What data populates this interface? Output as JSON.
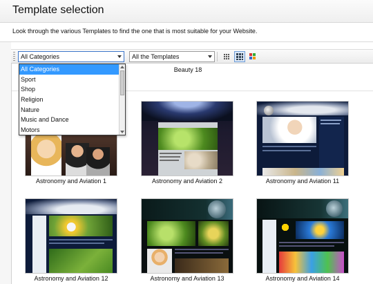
{
  "header": {
    "title": "Template selection",
    "description": "Look through the various Templates to find the one that is most suitable for your Website."
  },
  "toolbar": {
    "category_value": "All Categories",
    "template_filter_value": "All the Templates",
    "view_buttons": [
      "small-icons-icon",
      "medium-icons-icon",
      "large-icons-icon"
    ]
  },
  "category_dropdown": {
    "selected": "All Categories",
    "options": [
      "All Categories",
      "Sport",
      "Shop",
      "Religion",
      "Nature",
      "Music and Dance",
      "Motors"
    ]
  },
  "templates": {
    "partial_row_label": "Beauty 18",
    "items": [
      {
        "name": "Astronomy and Aviation 1"
      },
      {
        "name": "Astronomy and Aviation 2"
      },
      {
        "name": "Astronomy and Aviation 11"
      },
      {
        "name": "Astronomy and Aviation 12"
      },
      {
        "name": "Astronomy and Aviation 13"
      },
      {
        "name": "Astronomy and Aviation 14"
      }
    ]
  },
  "colors": {
    "selection_blue": "#3399ff",
    "dark_navy": "#0d1b3a",
    "leaf_green": "#5fa52a"
  }
}
